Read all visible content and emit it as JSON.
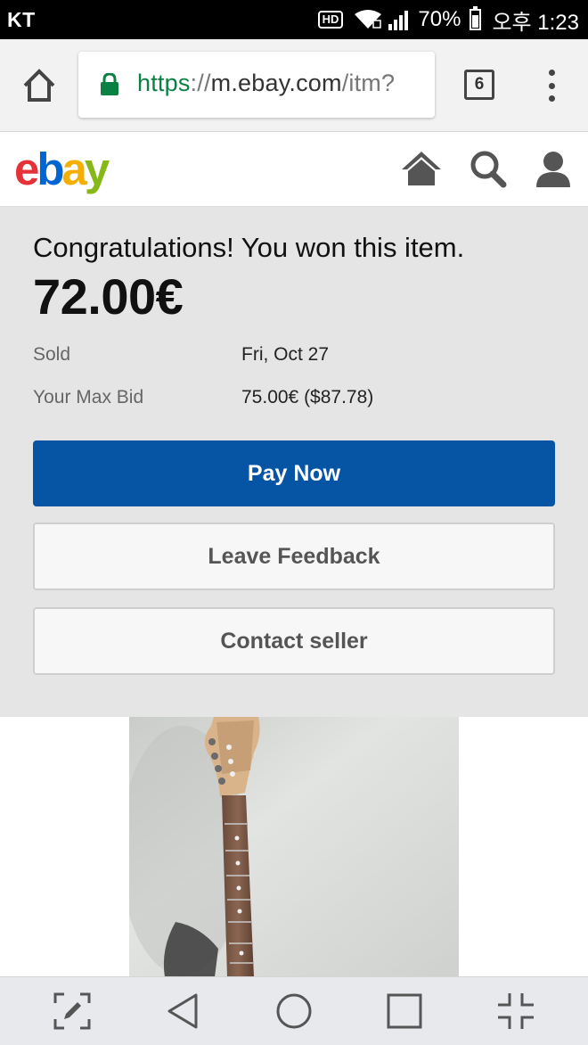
{
  "status_bar": {
    "carrier": "KT",
    "hd_badge": "HD",
    "battery": "70%",
    "time": "오후 1:23",
    "icons": [
      "hd-icon",
      "wifi-icon",
      "signal-icon",
      "battery-icon"
    ]
  },
  "browser": {
    "url_scheme": "https",
    "url_sep": "://",
    "url_host": "m.ebay.com",
    "url_path": "/itm?",
    "tab_count": "6",
    "icons": [
      "home-icon",
      "lock-icon",
      "tabs-icon",
      "overflow-menu-icon"
    ]
  },
  "ebay_header": {
    "logo": {
      "e": "e",
      "b": "b",
      "a": "a",
      "y": "y"
    },
    "icons": [
      "home-icon",
      "search-icon",
      "account-icon"
    ]
  },
  "won_panel": {
    "message": "Congratulations! You won this item.",
    "price": "72.00€",
    "details": [
      {
        "label": "Sold",
        "value": "Fri, Oct 27"
      },
      {
        "label": "Your Max Bid",
        "value": "75.00€ ($87.78)"
      }
    ],
    "buttons": {
      "pay_now": "Pay Now",
      "leave_feedback": "Leave Feedback",
      "contact_seller": "Contact seller"
    }
  },
  "item": {
    "image": "guitar-photo"
  },
  "nav_bar": {
    "icons": [
      "capture-icon",
      "back-icon",
      "home-icon",
      "recents-icon",
      "exit-fullscreen-icon"
    ]
  },
  "colors": {
    "pay_button": "#0654a4",
    "panel_bg": "#e5e5e5",
    "url_scheme": "#0b8043",
    "logo_red": "#e53238",
    "logo_blue": "#0064d2",
    "logo_yellow": "#f5af02",
    "logo_green": "#86b817"
  }
}
